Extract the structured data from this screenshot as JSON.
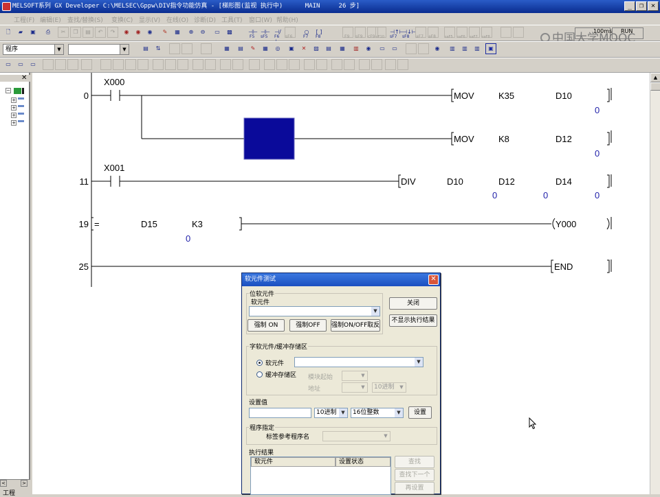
{
  "titlebar": {
    "title": "MELSOFT系列 GX Developer C:\\MELSEC\\Gppw\\DIV指令功能仿真 - [梯形图(监视 执行中)      MAIN     26 步]"
  },
  "menubar": {
    "items": [
      "工程(F)",
      "编辑(E)",
      "查找/替换(S)",
      "变换(C)",
      "显示(V)",
      "在线(O)",
      "诊断(D)",
      "工具(T)",
      "窗口(W)",
      "帮助(H)"
    ]
  },
  "toolbar": {
    "program_combo": "程序",
    "second_combo": "",
    "fkey_labels": [
      "F5",
      "sF5",
      "F6",
      "sF6",
      "F7",
      "F8",
      "F9",
      "sF9",
      "cF9",
      "cF10",
      "sF7",
      "sF8",
      "aF7",
      "aF8",
      "saF5",
      "saF6",
      "saF7",
      "saF8"
    ],
    "scan_time": "100ms",
    "run_state": "RUN"
  },
  "watermark": "中国大学MOOC",
  "project_panel": {
    "close": "✕",
    "footer_label": "工程"
  },
  "ladder": {
    "rungs": [
      {
        "step": "0",
        "contact": "X000",
        "instructions": [
          {
            "op": "MOV",
            "args": [
              "K35",
              "D10"
            ],
            "values": [
              "0"
            ]
          },
          {
            "op": "MOV",
            "args": [
              "K8",
              "D12"
            ],
            "values": [
              "0"
            ]
          }
        ]
      },
      {
        "step": "11",
        "contact": "X001",
        "instructions": [
          {
            "op": "DIV",
            "args": [
              "D10",
              "D12",
              "D14"
            ],
            "values": [
              "0",
              "0",
              "0"
            ]
          }
        ]
      },
      {
        "step": "19",
        "compare": {
          "op": "=",
          "arg1": "D15",
          "arg2": "K3",
          "value": "0"
        },
        "coil": "Y000"
      },
      {
        "step": "25",
        "end": "END"
      }
    ]
  },
  "dialog": {
    "title": "软元件测试",
    "bit_group": "位软元件",
    "bit_device_label": "软元件",
    "force_on": "强制 ON",
    "force_off": "强制OFF",
    "force_toggle": "强制ON/OFF取反",
    "close": "关闭",
    "hide_results": "不显示执行结果",
    "word_group": "字软元件/缓冲存储区",
    "radio_device": "软元件",
    "radio_buffer": "缓冲存储区",
    "module_start": "模块起始",
    "address": "地址",
    "address_radix": "10进制",
    "set_value_label": "设置值",
    "radix": "10进制",
    "data_type": "16位整数",
    "set_button": "设置",
    "program_group": "程序指定",
    "label_program": "标签参考程序名",
    "result_group": "执行结果",
    "col_device": "软元件",
    "col_state": "设置状态",
    "find": "查找",
    "find_next": "查找下一个",
    "reset": "再设置"
  }
}
